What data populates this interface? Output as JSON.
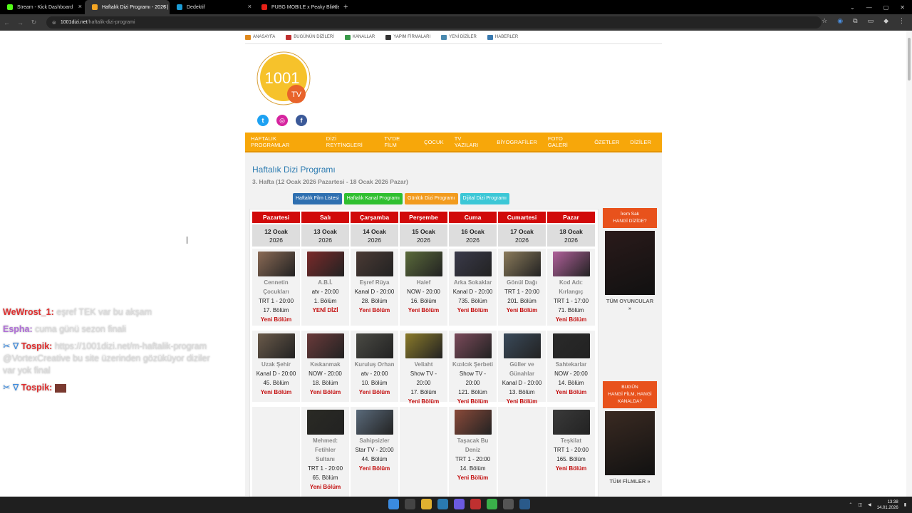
{
  "browser": {
    "tabs": [
      {
        "title": "Stream - Kick Dashboard",
        "color": "#53fc18"
      },
      {
        "title": "Haftalık Dizi Programı - 2026 |",
        "color": "#f5a623"
      },
      {
        "title": "Dedektif",
        "color": "#1b9cd6"
      },
      {
        "title": "PUBG MOBILE x Peaky Blinders",
        "color": "#e62117"
      }
    ],
    "url_host": "1001dizi.net",
    "url_path": "/haftalik-dizi-programi"
  },
  "topnav": [
    "ANASAYFA",
    "BUGÜNÜN DİZİLERİ",
    "KANALLAR",
    "YAPIM FİRMALARI",
    "YENİ DİZİLER",
    "HABERLER"
  ],
  "logo": {
    "number": "1001",
    "tv": "TV"
  },
  "mainnav": [
    "HAFTALIK PROGRAMLAR",
    "DİZİ REYTİNGLERİ",
    "TV'DE FİLM",
    "ÇOCUK",
    "TV YAZILARI",
    "BİYOGRAFİLER",
    "FOTO GALERİ",
    "ÖZETLER",
    "DİZİLER"
  ],
  "page_title": "Haftalık Dizi Programı",
  "page_subtitle": "3. Hafta (12 Ocak 2026 Pazartesi - 18 Ocak 2026 Pazar)",
  "buttons": [
    {
      "label": "Haftalık Film Listesi",
      "color": "#2e6fb0"
    },
    {
      "label": "Haftalık Kanal Programı",
      "color": "#2fbf2f"
    },
    {
      "label": "Günlük Dizi Programı",
      "color": "#f29b1e"
    },
    {
      "label": "Dijital Dizi Programı",
      "color": "#3cc7d6"
    }
  ],
  "days": [
    {
      "name": "Pazartesi",
      "date": "12 Ocak",
      "year": "2026"
    },
    {
      "name": "Salı",
      "date": "13 Ocak",
      "year": "2026"
    },
    {
      "name": "Çarşamba",
      "date": "14 Ocak",
      "year": "2026"
    },
    {
      "name": "Perşembe",
      "date": "15 Ocak",
      "year": "2026"
    },
    {
      "name": "Cuma",
      "date": "16 Ocak",
      "year": "2026"
    },
    {
      "name": "Cumartesi",
      "date": "17 Ocak",
      "year": "2026"
    },
    {
      "name": "Pazar",
      "date": "18 Ocak",
      "year": "2026"
    }
  ],
  "rows": [
    [
      {
        "title": [
          "Cennetin",
          "Çocukları"
        ],
        "channel": [
          "TRT 1 - 20:00"
        ],
        "episode": "17. Bölüm",
        "note": "Yeni Bölüm",
        "color": "#8a6a55"
      },
      {
        "title": [
          "A.B.İ."
        ],
        "channel": [
          "atv - 20:00"
        ],
        "episode": "1. Bölüm",
        "note": "YENİ DİZİ",
        "color": "#7a2a2a"
      },
      {
        "title": [
          "Eşref Rüya"
        ],
        "channel": [
          "Kanal D - 20:00"
        ],
        "episode": "28. Bölüm",
        "note": "Yeni Bölüm",
        "color": "#4a3a34"
      },
      {
        "title": [
          "Halef"
        ],
        "channel": [
          "NOW - 20:00"
        ],
        "episode": "16. Bölüm",
        "note": "Yeni Bölüm",
        "color": "#5a6a3a"
      },
      {
        "title": [
          "Arka Sokaklar"
        ],
        "channel": [
          "Kanal D - 20:00"
        ],
        "episode": "735. Bölüm",
        "note": "Yeni Bölüm",
        "color": "#3a3a4a"
      },
      {
        "title": [
          "Gönül Dağı"
        ],
        "channel": [
          "TRT 1 - 20:00"
        ],
        "episode": "201. Bölüm",
        "note": "Yeni Bölüm",
        "color": "#8a7a5a"
      },
      {
        "title": [
          "Kod Adı:",
          "Kırlangıç"
        ],
        "channel": [
          "TRT 1 - 17:00"
        ],
        "episode": "71. Bölüm",
        "note": "Yeni Bölüm",
        "color": "#b0609a"
      }
    ],
    [
      {
        "title": [
          "Uzak Şehir"
        ],
        "channel": [
          "Kanal D - 20:00"
        ],
        "episode": "45. Bölüm",
        "note": "Yeni Bölüm",
        "color": "#6a5a4a"
      },
      {
        "title": [
          "Kıskanmak"
        ],
        "channel": [
          "NOW - 20:00"
        ],
        "episode": "18. Bölüm",
        "note": "Yeni Bölüm",
        "color": "#6a3a3a"
      },
      {
        "title": [
          "Kuruluş Orhan"
        ],
        "channel": [
          "atv - 20:00"
        ],
        "episode": "10. Bölüm",
        "note": "Yeni Bölüm",
        "color": "#4a4a44"
      },
      {
        "title": [
          "Veliaht"
        ],
        "channel": [
          "Show TV -",
          "20:00"
        ],
        "episode": "17. Bölüm",
        "note": "Yeni Bölüm",
        "color": "#8a7a2a"
      },
      {
        "title": [
          "Kızılcık Şerbeti"
        ],
        "channel": [
          "Show TV -",
          "20:00"
        ],
        "episode": "121. Bölüm",
        "note": "Yeni Bölüm",
        "color": "#7a4a5a"
      },
      {
        "title": [
          "Güller ve",
          "Günahlar"
        ],
        "channel": [
          "Kanal D - 20:00"
        ],
        "episode": "13. Bölüm",
        "note": "Yeni Bölüm",
        "color": "#3a4a5a"
      },
      {
        "title": [
          "Sahtekarlar"
        ],
        "channel": [
          "NOW - 20:00"
        ],
        "episode": "14. Bölüm",
        "note": "Yeni Bölüm",
        "color": "#2a2a2a"
      }
    ],
    [
      null,
      {
        "title": [
          "Mehmed:",
          "Fetihler",
          "Sultanı"
        ],
        "channel": [
          "TRT 1 - 20:00"
        ],
        "episode": "65. Bölüm",
        "note": "Yeni Bölüm",
        "color": "#2a2a24"
      },
      {
        "title": [
          "Sahipsizler"
        ],
        "channel": [
          "Star TV - 20:00"
        ],
        "episode": "44. Bölüm",
        "note": "Yeni Bölüm",
        "color": "#5a6a7a"
      },
      null,
      {
        "title": [
          "Taşacak Bu",
          "Deniz"
        ],
        "channel": [
          "TRT 1 - 20:00"
        ],
        "episode": "14. Bölüm",
        "note": "Yeni Bölüm",
        "color": "#8a4a3a"
      },
      null,
      {
        "title": [
          "Teşkilat"
        ],
        "channel": [
          "TRT 1 - 20:00"
        ],
        "episode": "165. Bölüm",
        "note": "Yeni Bölüm",
        "color": "#3a3a3a"
      }
    ]
  ],
  "sidebar": [
    {
      "header": [
        "İrem Sak",
        "HANGİ DİZİDE?"
      ],
      "link": [
        "TÜM OYUNCULAR",
        "»"
      ],
      "poster_color": "#2a1a1a"
    },
    {
      "header": [
        "BUGÜN",
        "HANGİ FİLM, HANGİ",
        "KANALDA?"
      ],
      "link": [
        "TÜM FİLMLER »"
      ],
      "poster_color": "#3a2a22"
    }
  ],
  "chat": [
    {
      "user": "WeWrost_1:",
      "text": "eşref TEK var bu akşam",
      "color": "#e03030",
      "badge": ""
    },
    {
      "user": "Espha:",
      "text": "cuma günü sezon finali",
      "color": "#b06ed8",
      "badge": ""
    },
    {
      "user": "Tospik:",
      "text": "https://1001dizi.net/m-haftalik-program @VortexCreative bu site üzerinden gözüküyor diziler var yok final",
      "color": "#e03030",
      "badge": "✂ ∇"
    },
    {
      "user": "Tospik:",
      "text": "",
      "color": "#e03030",
      "badge": "✂ ∇"
    }
  ],
  "clock": {
    "time": "13:38",
    "date": "14.01.2026"
  }
}
